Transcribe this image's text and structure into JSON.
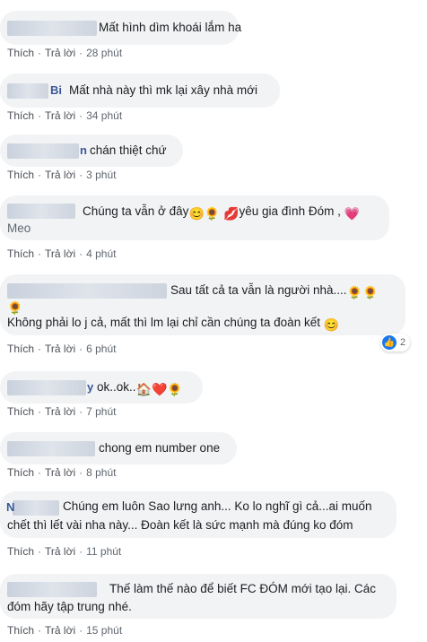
{
  "actions": {
    "like": "Thích",
    "reply": "Trả lời",
    "separator": "·"
  },
  "comments": [
    {
      "author": "",
      "text": "Mất hình dìm khoái lắm ha",
      "time": "28 phút"
    },
    {
      "author": "Bi",
      "text": "Mất nhà này thì mk lại xây nhà mới",
      "time": "34 phút"
    },
    {
      "author": "n",
      "text": "chán thiệt chứ",
      "time": "3 phút"
    },
    {
      "author": "",
      "line1": "Chúng ta vẫn ở đây",
      "line1b": "yêu gia đình Đóm ,",
      "line2": "Meo",
      "time": "4 phút"
    },
    {
      "author": "",
      "line1": "Sau tất cả ta vẫn là người nhà....",
      "line2": "Không phải lo j cả, mất thì lm lại chỉ cần chúng ta đoàn kết",
      "reaction_count": "2",
      "time": "6 phút"
    },
    {
      "author": "y",
      "text": "ok..ok..",
      "time": "7 phút"
    },
    {
      "author": "",
      "text": "chong em number one",
      "time": "8 phút"
    },
    {
      "author": "N",
      "line1": "Chúng em luôn Sao lưng anh... Ko lo nghĩ gì cả...ai muốn",
      "line2": "chết thì lết vài nha này... Đoàn kết là sức mạnh mà đúng ko đóm",
      "time": "11 phút"
    },
    {
      "author": "",
      "line1": "Thế làm thế nào để biết FC ĐÓM mới tạo lại. Các",
      "line2": "đóm hãy tập trung nhé.",
      "time": "15 phút"
    }
  ],
  "icons": {
    "sunflower": "🌻",
    "smile": "😊",
    "kiss": "💋",
    "heart": "💗",
    "red_heart": "❤️",
    "house": "🏠",
    "like": "👍"
  }
}
